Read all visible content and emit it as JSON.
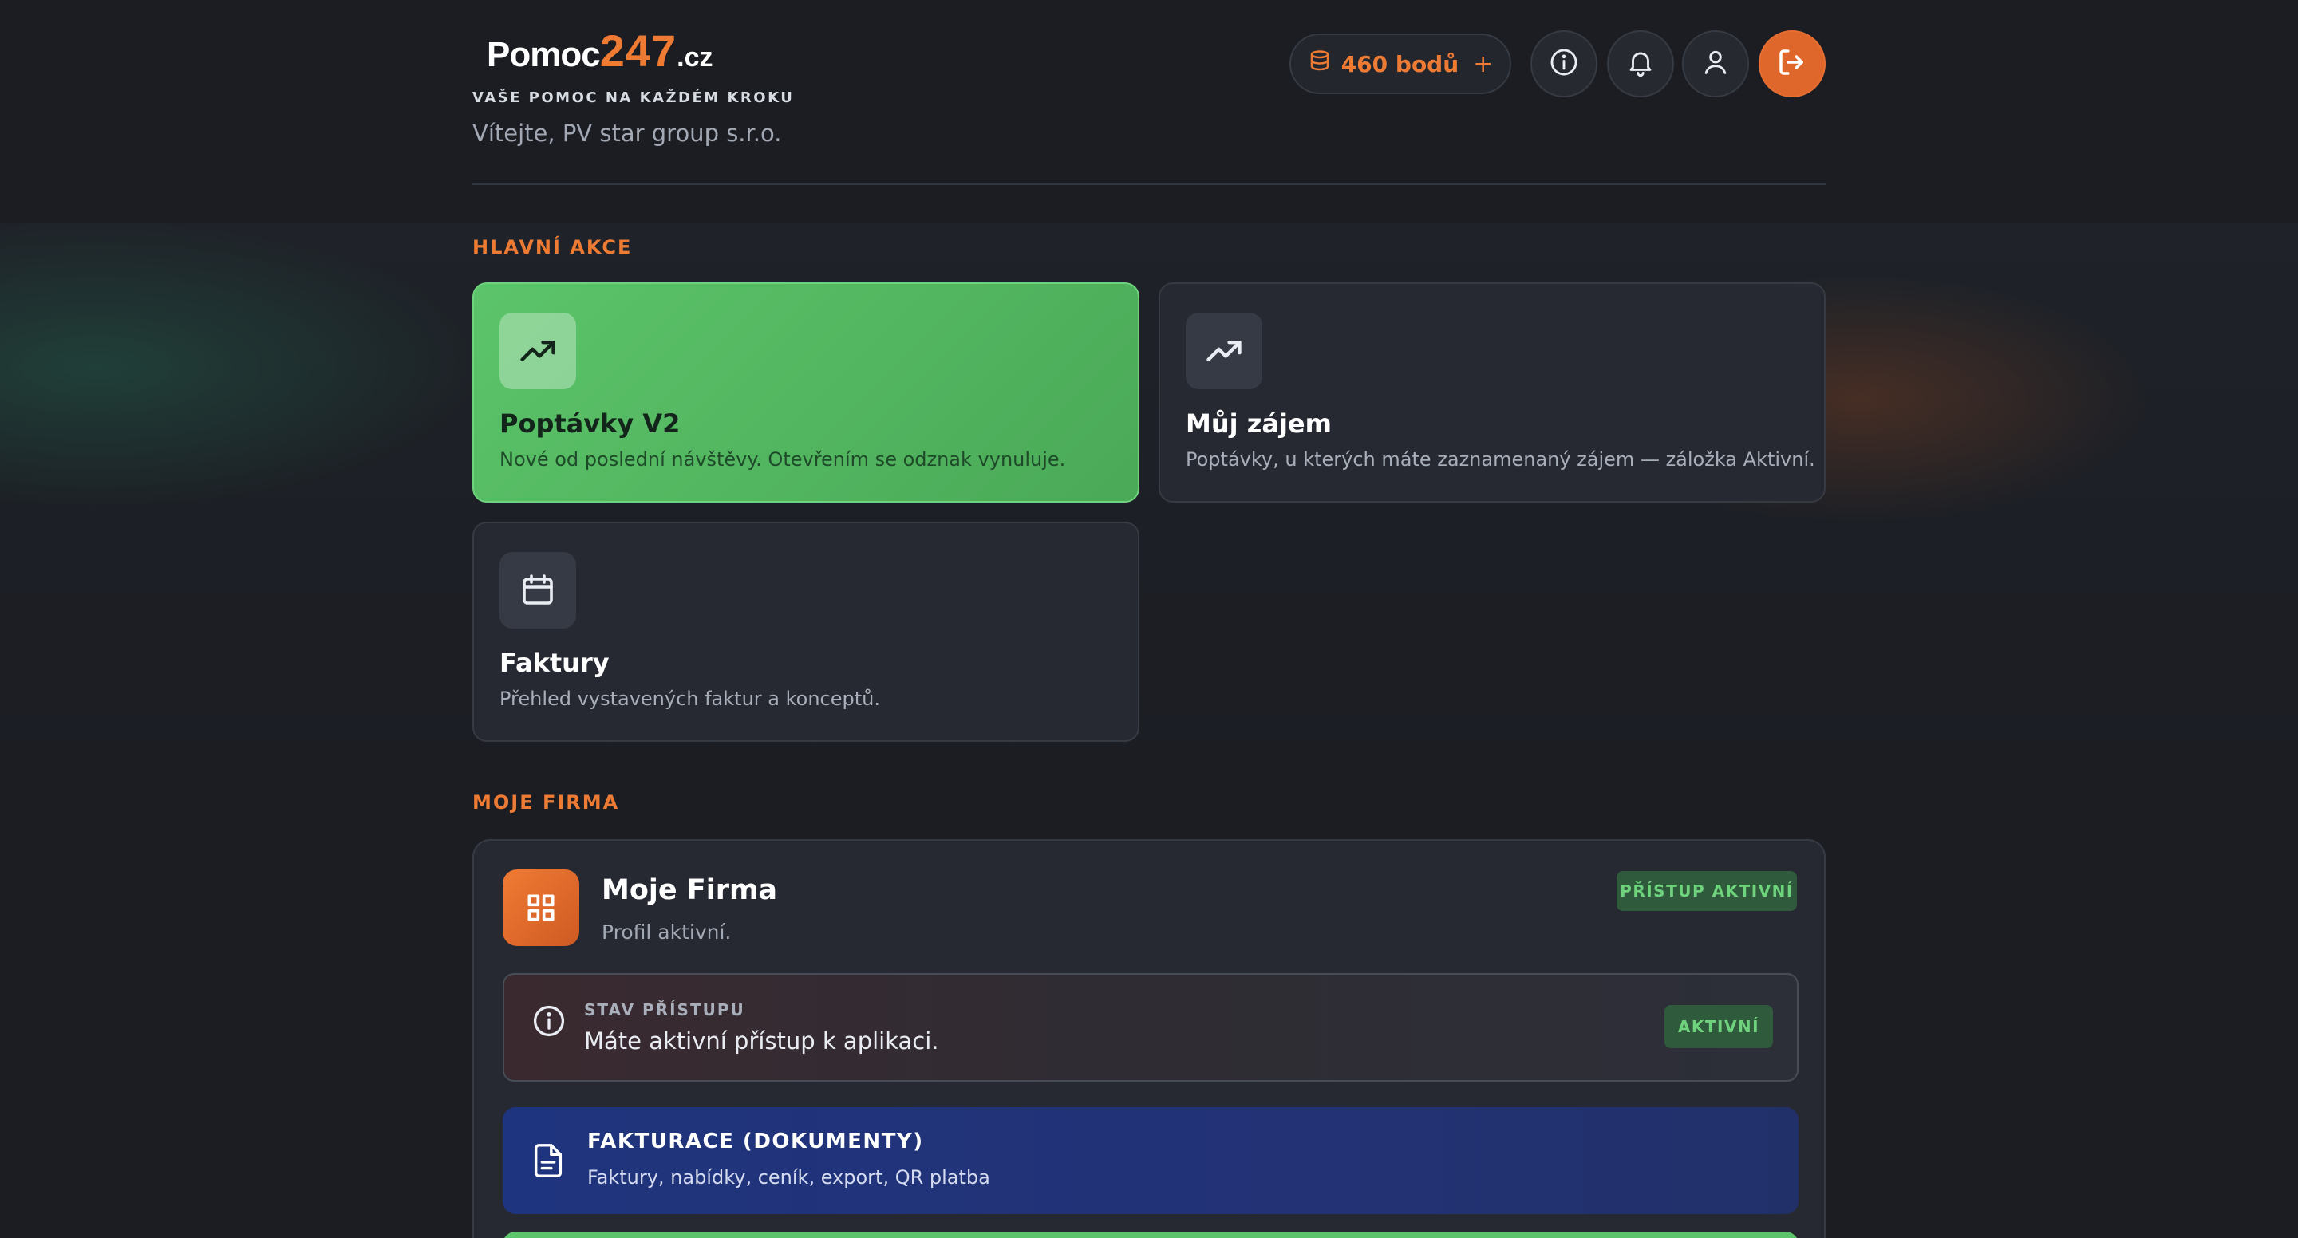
{
  "brand": {
    "logo_part1": "Pomoc",
    "logo_part2": "247",
    "logo_part3": ".cz",
    "tagline": "VAŠE POMOC NA KAŽDÉM KROKU",
    "welcome": "Vítejte, PV star group s.r.o."
  },
  "header": {
    "points_label": "460 bodů",
    "points_plus": "+",
    "icons": [
      "database-icon",
      "info-icon",
      "bell-icon",
      "user-icon",
      "logout-icon"
    ]
  },
  "sections": {
    "main_actions": "HLAVNÍ AKCE",
    "my_company": "MOJE FIRMA"
  },
  "cards": [
    {
      "title": "Poptávky V2",
      "desc": "Nové od poslední návštěvy. Otevřením se odznak vynuluje.",
      "icon": "trending-up-icon"
    },
    {
      "title": "Můj zájem",
      "desc": "Poptávky, u kterých máte zaznamenaný zájem — záložka Aktivní.",
      "icon": "trending-up-icon"
    },
    {
      "title": "Faktury",
      "desc": "Přehled vystavených faktur a konceptů.",
      "icon": "calendar-icon"
    }
  ],
  "firm": {
    "title": "Moje Firma",
    "subtitle": "Profil aktivní.",
    "access_badge": "PŘÍSTUP AKTIVNÍ",
    "status": {
      "label": "STAV PŘÍSTUPU",
      "text": "Máte aktivní přístup k aplikaci.",
      "badge": "AKTIVNÍ"
    },
    "billing": {
      "title": "FAKTURACE (DOKUMENTY)",
      "desc": "Faktury, nabídky, ceník, export, QR platba"
    }
  },
  "colors": {
    "accent": "#ee7b33",
    "green": "#5cc46a",
    "background": "#1b1d23",
    "card": "#262931",
    "billing_blue": "#1f347e"
  }
}
